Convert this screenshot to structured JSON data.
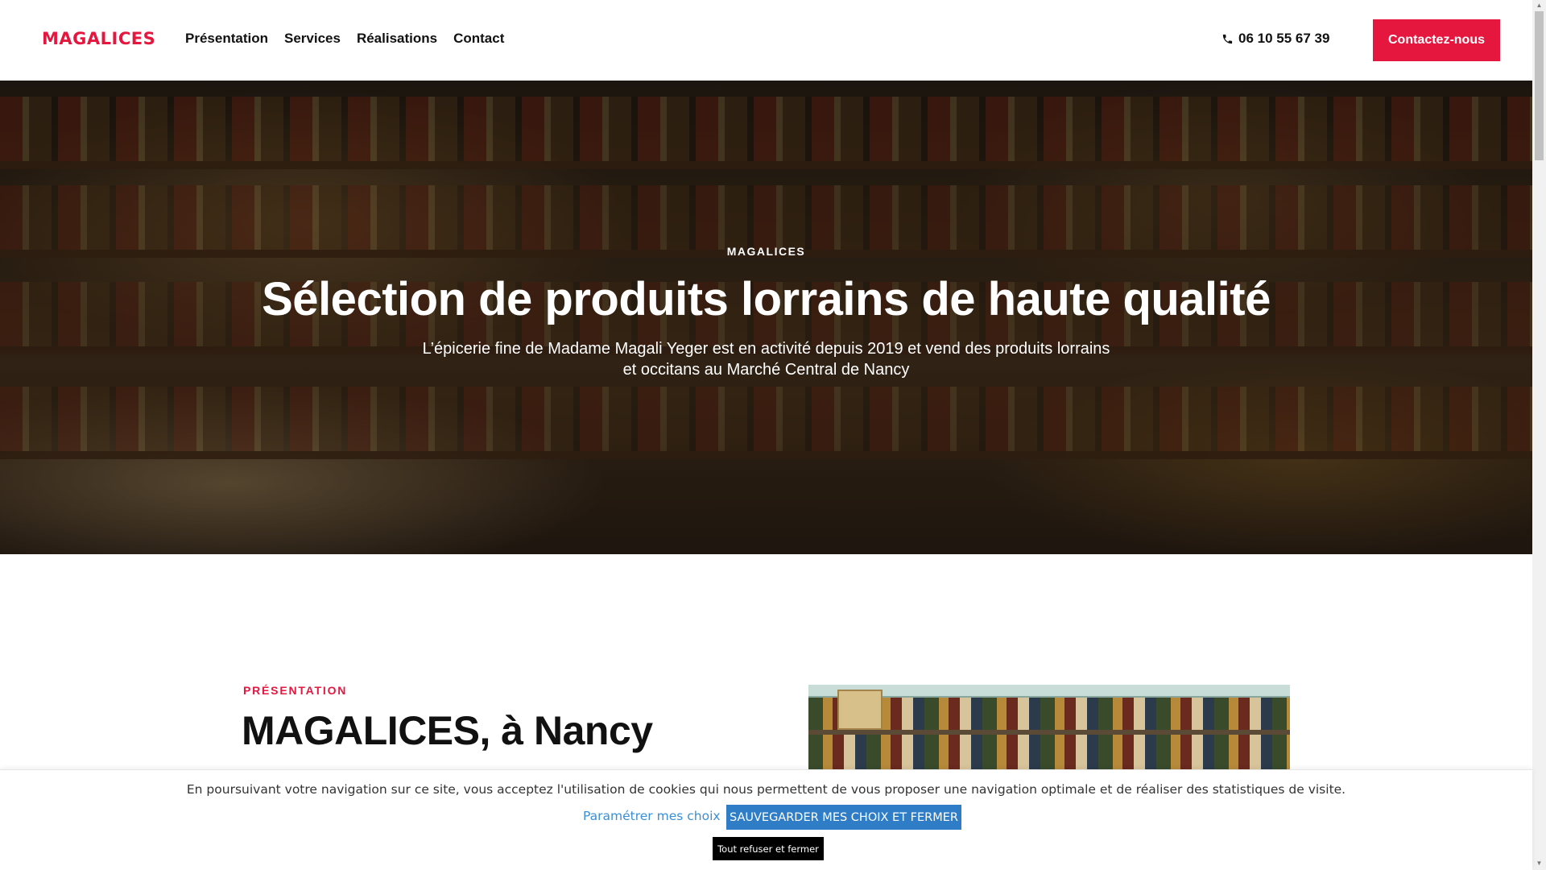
{
  "header": {
    "logo": "MAGALICES",
    "nav": [
      "Présentation",
      "Services",
      "Réalisations",
      "Contact"
    ],
    "phone": "06 10 55 67 39",
    "cta_label": "Contactez-nous"
  },
  "hero": {
    "eyebrow": "MAGALICES",
    "title": "Sélection de produits lorrains de haute qualité",
    "subtitle": "L’épicerie fine de Madame Magali Yeger est en activité depuis 2019 et vend des produits lorrains et occitans au Marché Central de Nancy"
  },
  "presentation": {
    "eyebrow": "PRÉSENTATION",
    "title": "MAGALICES, à Nancy"
  },
  "cookie": {
    "text": "En poursuivant votre navigation sur ce site, vous acceptez l'utilisation de cookies qui nous permettent de vous proposer une navigation optimale et de réaliser des statistiques de visite.",
    "settings_label": "Paramétrer mes choix",
    "save_label": "SAUVEGARDER MES CHOIX ET FERMER",
    "refuse_label": "Tout refuser et fermer"
  },
  "colors": {
    "accent": "#e5173f",
    "cookie_button": "#2f7dc7",
    "link": "#3a8fd6"
  },
  "icons": {
    "phone": "phone-icon"
  }
}
